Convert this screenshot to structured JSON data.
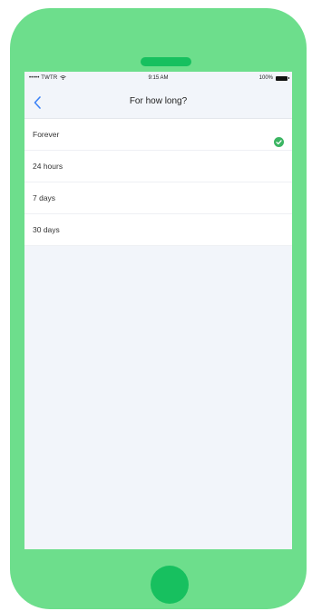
{
  "colors": {
    "phone_body": "#6dde8c",
    "speaker": "#17c05f",
    "home_button": "#17c05f",
    "accent": "#3b82f6",
    "check": "#3bb562"
  },
  "status_bar": {
    "carrier": "••••• TWTR",
    "time": "9:15 AM",
    "battery": "100%"
  },
  "nav": {
    "back_icon": "chevron-left-icon",
    "title": "For how long?"
  },
  "options": [
    {
      "label": "Forever",
      "selected": true
    },
    {
      "label": "24 hours",
      "selected": false
    },
    {
      "label": "7 days",
      "selected": false
    },
    {
      "label": "30 days",
      "selected": false
    }
  ]
}
